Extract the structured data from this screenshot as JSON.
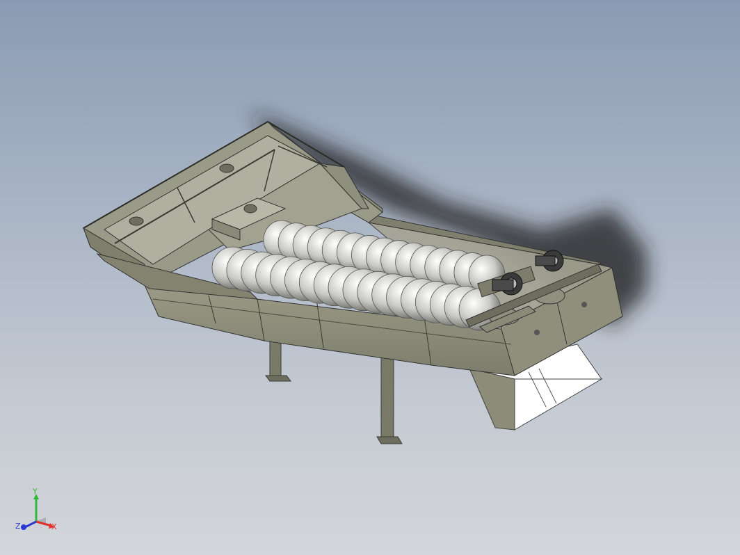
{
  "viewport": {
    "background_top": "#8a9bb3",
    "background_bottom": "#d3d6da"
  },
  "model": {
    "description_icon": "spiral-sand-washer-model",
    "body_color": "#8e8e7a",
    "shadow_color": "#2a2a2a",
    "screw_color": "#d9d9d6",
    "chute_color": "#ffffff",
    "motor_color": "#3a3a3a"
  },
  "triad": {
    "x_label": "X",
    "y_label": "Y",
    "z_label": "Z",
    "x_color": "#e0302a",
    "y_color": "#2fb83a",
    "z_color": "#2a3ad0"
  }
}
